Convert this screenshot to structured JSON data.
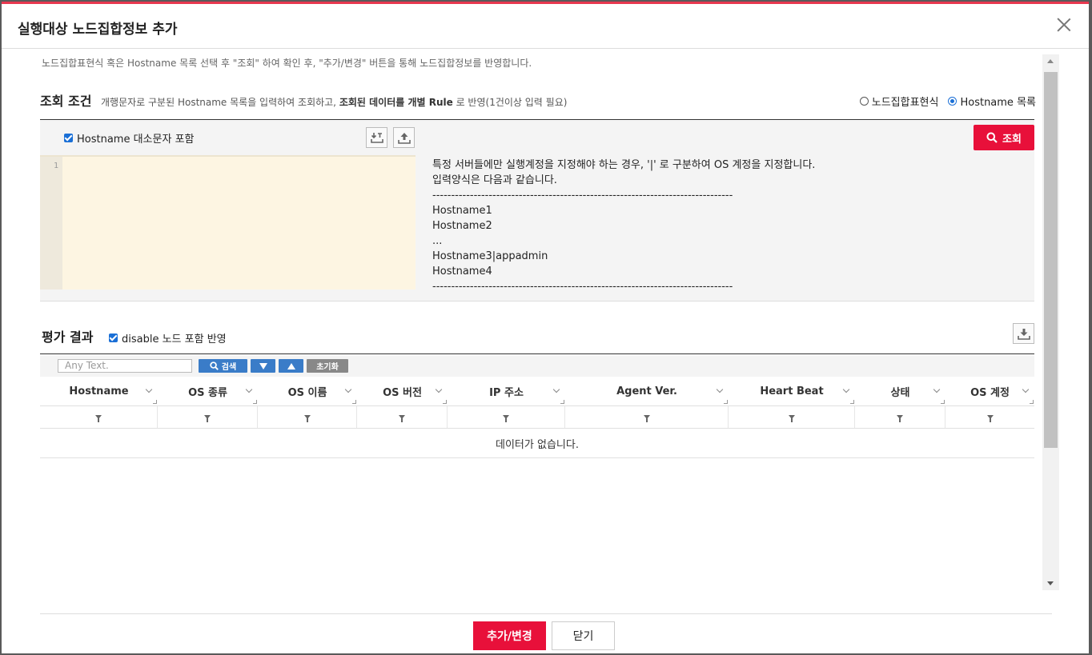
{
  "modal": {
    "title": "실행대상 노드집합정보 추가"
  },
  "notice": "노드집합표현식 혹은 Hostname 목록 선택 후 \"조회\" 하여 확인 후, \"추가/변경\" 버튼을 통해 노드집합정보를 반영합니다.",
  "condition": {
    "title": "조회 조건",
    "desc_prefix": "개행문자로 구분된 Hostname 목록을 입력하여 조회하고, ",
    "desc_bold": "조회된 데이터를 개별 Rule",
    "desc_suffix": " 로 반영(1건이상 입력 필요)",
    "radio_expr": "노드집합표현식",
    "radio_hostname": "Hostname 목록",
    "case_checkbox": "Hostname 대소문자 포함",
    "search_button": "조회",
    "editor_line": "1",
    "help_text": "특정 서버들에만 실행계정을 지정해야 하는 경우, '|' 로 구분하여 OS 계정을 지정합니다.\n입력양식은 다음과 같습니다.\n--------------------------------------------------------------------------------\nHostname1\nHostname2\n...\nHostname3|appadmin\nHostname4\n--------------------------------------------------------------------------------"
  },
  "result": {
    "title": "평가 결과",
    "disable_checkbox": "disable 노드 포함 반영",
    "search_placeholder": "Any Text.",
    "search_btn": "검색",
    "reset_btn": "초기화",
    "columns": [
      "Hostname",
      "OS 종류",
      "OS 이름",
      "OS 버전",
      "IP 주소",
      "Agent Ver.",
      "Heart Beat",
      "상태",
      "OS 계정"
    ],
    "empty_message": "데이터가 없습니다."
  },
  "footer": {
    "save": "추가/변경",
    "close": "닫기"
  },
  "colors": {
    "accent": "#e8103a",
    "blue": "#3a7cc8"
  }
}
